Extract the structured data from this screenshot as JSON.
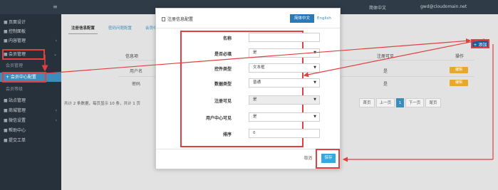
{
  "topbar": {
    "menu_icon": "menu-icon",
    "language": "简体中文",
    "user_email": "gwd@cloudomain.net"
  },
  "sidebar": {
    "items": [
      {
        "icon": "home-icon",
        "label": "页面设计"
      },
      {
        "icon": "dashboard-icon",
        "label": "控制面板"
      },
      {
        "icon": "content-icon",
        "label": "内容管理"
      },
      {
        "icon": "member-icon",
        "label": "会员管理"
      },
      {
        "label": "会员管理"
      },
      {
        "label": "+ 会员中心配置"
      },
      {
        "label": "会员等级"
      },
      {
        "icon": "site-icon",
        "label": "站点管理"
      },
      {
        "icon": "shop-icon",
        "label": "商城管理"
      },
      {
        "icon": "wechat-icon",
        "label": "微信设置"
      },
      {
        "icon": "help-icon",
        "label": "帮助中心"
      },
      {
        "icon": "ticket-icon",
        "label": "提交工单"
      }
    ]
  },
  "content": {
    "tabs": [
      "注册信息配置",
      "密码问题配置",
      "会员中心"
    ],
    "add_button": "+ 添加",
    "table": {
      "headers": [
        "信息项",
        "注册可见",
        "操作"
      ],
      "rows": [
        {
          "name": "用户名",
          "visible": "是",
          "action": "编辑"
        },
        {
          "name": "密码",
          "visible": "是",
          "action": "编辑"
        }
      ]
    },
    "total_text": "共计 2 条数据，每页显示 10 条，共计 1 页",
    "pager": [
      "首页",
      "上一页",
      "1",
      "下一页",
      "尾页"
    ]
  },
  "modal": {
    "title": "注册信息配置",
    "lang_cn": "简体中文",
    "lang_en": "English",
    "fields": [
      {
        "label": "名称",
        "value": "",
        "type": "text"
      },
      {
        "label": "是否必填",
        "value": "是",
        "type": "select"
      },
      {
        "label": "控件类型",
        "value": "文本框",
        "type": "select"
      },
      {
        "label": "数据类型",
        "value": "普通",
        "type": "select"
      },
      {
        "label": "注册可见",
        "value": "是",
        "type": "select-disabled"
      },
      {
        "label": "用户中心可见",
        "value": "是",
        "type": "select"
      },
      {
        "label": "排序",
        "value": "0",
        "type": "text"
      }
    ],
    "cancel_label": "取消",
    "save_label": "保存"
  },
  "colors": {
    "annotation_red": "#e24040",
    "primary_blue": "#2a7ab8",
    "save_blue": "#34a9dd",
    "edit_orange": "#e8a92b",
    "sidebar_dark": "#27313b"
  }
}
